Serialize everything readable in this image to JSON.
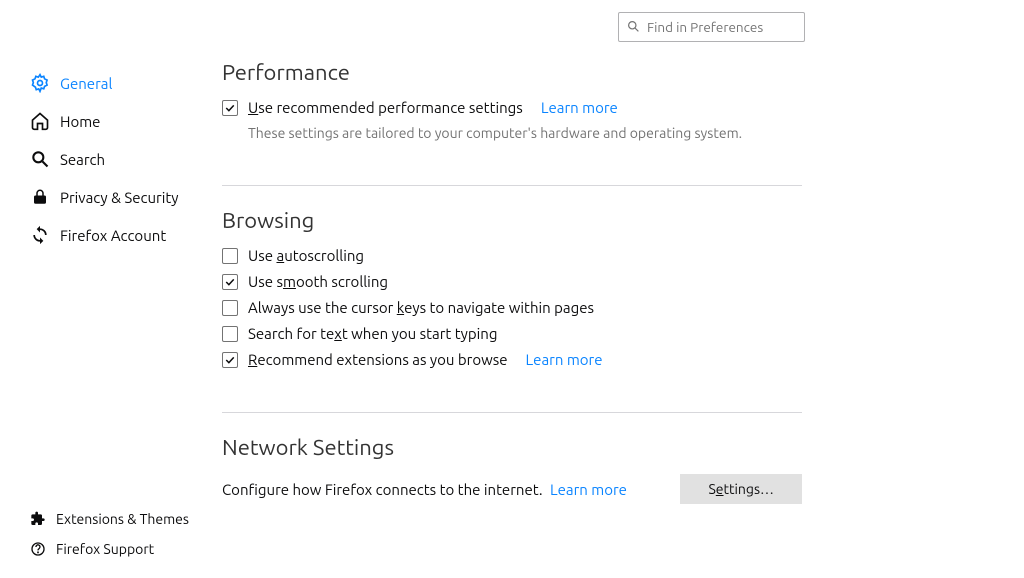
{
  "search": {
    "placeholder": "Find in Preferences"
  },
  "sidebar": {
    "items": [
      {
        "label": "General"
      },
      {
        "label": "Home"
      },
      {
        "label": "Search"
      },
      {
        "label": "Privacy & Security"
      },
      {
        "label": "Firefox Account"
      }
    ],
    "footer": [
      {
        "label": "Extensions & Themes"
      },
      {
        "label": "Firefox Support"
      }
    ]
  },
  "performance": {
    "heading": "Performance",
    "recommend_pre": "U",
    "recommend_post": "se recommended performance settings",
    "learn_more": "Learn more",
    "hint": "These settings are tailored to your computer's hardware and operating system."
  },
  "browsing": {
    "heading": "Browsing",
    "autoscroll_pre": "Use ",
    "autoscroll_key": "a",
    "autoscroll_post": "utoscrolling",
    "smooth_pre": "Use s",
    "smooth_key": "m",
    "smooth_post": "ooth scrolling",
    "cursor_pre": "Always use the cursor ",
    "cursor_key": "k",
    "cursor_post": "eys to navigate within pages",
    "searchtext_pre": "Search for te",
    "searchtext_key": "x",
    "searchtext_post": "t when you start typing",
    "recext_pre": "R",
    "recext_post": "ecommend extensions as you browse",
    "learn_more": "Learn more"
  },
  "network": {
    "heading": "Network Settings",
    "desc": "Configure how Firefox connects to the internet.",
    "learn_more": "Learn more",
    "settings_pre": "S",
    "settings_key": "e",
    "settings_post": "ttings…"
  }
}
